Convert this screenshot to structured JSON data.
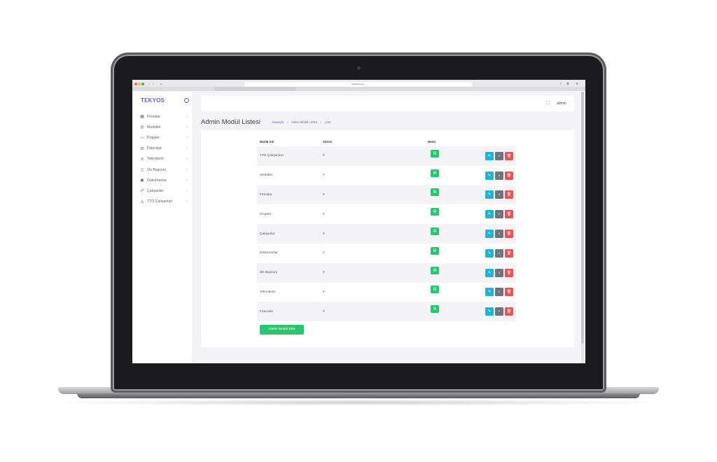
{
  "browser": {
    "url": "pardtech.com"
  },
  "sidebar": {
    "brand": "TEKYOS",
    "items": [
      {
        "label": "Firmalar",
        "icon": "building-icon"
      },
      {
        "label": "Modüller",
        "icon": "globe-icon"
      },
      {
        "label": "Projeler",
        "icon": "folder-icon"
      },
      {
        "label": "Faturalar",
        "icon": "inbox-icon"
      },
      {
        "label": "Teknokent",
        "icon": "layers-icon"
      },
      {
        "label": "Ön Başvuru",
        "icon": "clipboard-icon"
      },
      {
        "label": "Dökümanlar",
        "icon": "box-icon"
      },
      {
        "label": "Çalışanlar",
        "icon": "users-icon"
      },
      {
        "label": "TTO Çalışanları",
        "icon": "user-icon"
      }
    ]
  },
  "topbar": {
    "user": "admin"
  },
  "page": {
    "title": "Admin Modül Listesi",
    "breadcrumb": [
      "Anasayfa",
      "Admin Modül Listesi",
      "Liste"
    ]
  },
  "table": {
    "headers": [
      "Modül Adı",
      "Adresi",
      "Menü"
    ],
    "rows": [
      {
        "name": "TTO Çalışanları",
        "address": "#"
      },
      {
        "name": "Modüller",
        "address": "#"
      },
      {
        "name": "Firmalar",
        "address": "#"
      },
      {
        "name": "Projeler",
        "address": "#"
      },
      {
        "name": "Çalışanlar",
        "address": "#"
      },
      {
        "name": "Dökümanlar",
        "address": "#"
      },
      {
        "name": "Ön Başvuru",
        "address": "#"
      },
      {
        "name": "Teknokent",
        "address": "#"
      },
      {
        "name": "Faturalar",
        "address": "#"
      }
    ]
  },
  "actions": {
    "add_label": "Admin Modül Ekle"
  },
  "colors": {
    "accent": "#6b5fd3",
    "success": "#28c76f",
    "info": "#1fb6d6",
    "secondary": "#6c757d",
    "danger": "#ea5455"
  }
}
